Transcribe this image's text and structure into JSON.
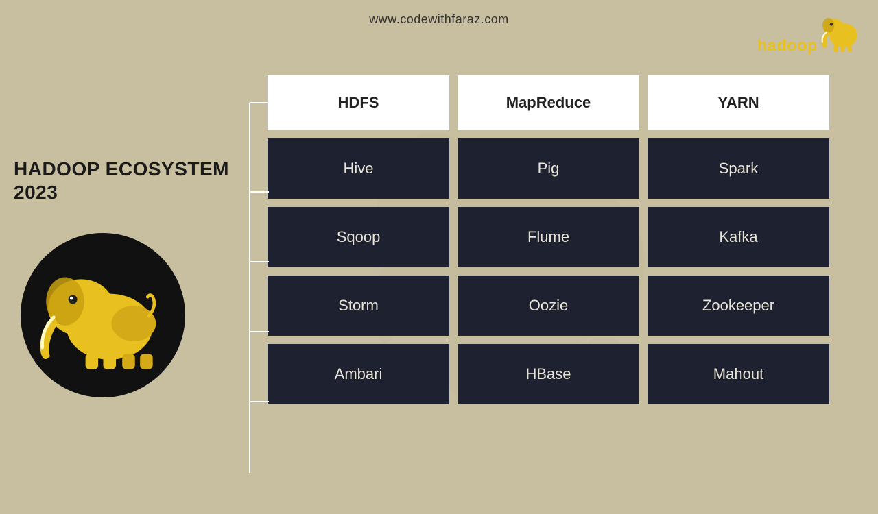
{
  "header": {
    "url": "www.codewithfaraz.com"
  },
  "title": {
    "line1": "HADOOP ECOSYSTEM",
    "line2": "2023"
  },
  "top_boxes": [
    {
      "label": "HDFS"
    },
    {
      "label": "MapReduce"
    },
    {
      "label": "YARN"
    }
  ],
  "grid": [
    [
      {
        "label": "Hive"
      },
      {
        "label": "Pig"
      },
      {
        "label": "Spark"
      }
    ],
    [
      {
        "label": "Sqoop"
      },
      {
        "label": "Flume"
      },
      {
        "label": "Kafka"
      }
    ],
    [
      {
        "label": "Storm"
      },
      {
        "label": "Oozie"
      },
      {
        "label": "Zookeeper"
      }
    ],
    [
      {
        "label": "Ambari"
      },
      {
        "label": "HBase"
      },
      {
        "label": "Mahout"
      }
    ]
  ],
  "colors": {
    "background": "#c8bfa0",
    "dark_box": "#1e2130",
    "white_box": "#ffffff",
    "text_dark": "#1a1a1a",
    "text_light": "#e8e4d8"
  }
}
